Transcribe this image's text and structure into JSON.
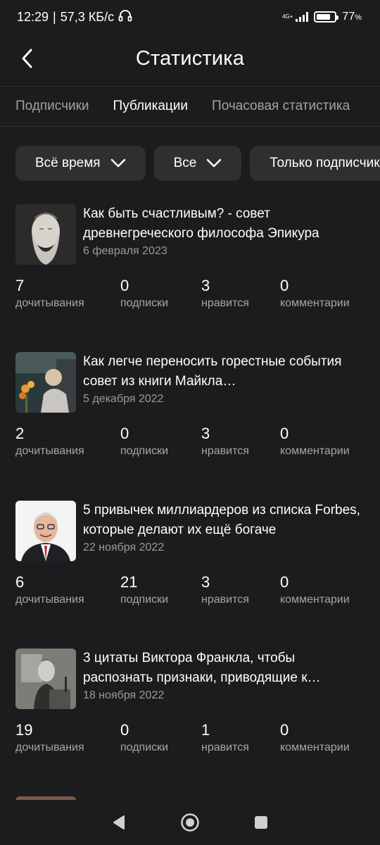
{
  "status_bar": {
    "time": "12:29",
    "separator": "|",
    "speed": "57,3 КБ/с",
    "network": "4G+",
    "battery_level": 0.77,
    "battery_text": "77",
    "battery_unit": "%",
    "icons": [
      "headphones-icon",
      "signal-icon",
      "battery-icon"
    ]
  },
  "header": {
    "title": "Статистика",
    "back_icon": "chevron-left-icon"
  },
  "tabs": [
    {
      "label": "Подписчики",
      "active": false
    },
    {
      "label": "Публикации",
      "active": true
    },
    {
      "label": "Почасовая статистика",
      "active": false
    }
  ],
  "filters": [
    {
      "label": "Всё время",
      "icon": "chevron-down-icon"
    },
    {
      "label": "Все",
      "icon": "chevron-down-icon"
    },
    {
      "label": "Только подписчики"
    }
  ],
  "posts": [
    {
      "title": "Как быть счастливым? - совет древнегреческого философа Эпикура",
      "date": "6 февраля 2023",
      "stats": [
        {
          "value": "7",
          "label": "дочитывания"
        },
        {
          "value": "0",
          "label": "подписки"
        },
        {
          "value": "3",
          "label": "нравится"
        },
        {
          "value": "0",
          "label": "комментарии"
        }
      ]
    },
    {
      "title": "Как легче переносить горестные события совет из книги Майкла…",
      "date": "5 декабря 2022",
      "stats": [
        {
          "value": "2",
          "label": "дочитывания"
        },
        {
          "value": "0",
          "label": "подписки"
        },
        {
          "value": "3",
          "label": "нравится"
        },
        {
          "value": "0",
          "label": "комментарии"
        }
      ]
    },
    {
      "title": "5 привычек миллиардеров из списка Forbes, которые делают их ещё богаче",
      "date": "22 ноября 2022",
      "stats": [
        {
          "value": "6",
          "label": "дочитывания"
        },
        {
          "value": "21",
          "label": "подписки"
        },
        {
          "value": "3",
          "label": "нравится"
        },
        {
          "value": "0",
          "label": "комментарии"
        }
      ]
    },
    {
      "title": "3 цитаты Виктора Франкла, чтобы распознать признаки, приводящие к…",
      "date": "18 ноября 2022",
      "stats": [
        {
          "value": "19",
          "label": "дочитывания"
        },
        {
          "value": "0",
          "label": "подписки"
        },
        {
          "value": "1",
          "label": "нравится"
        },
        {
          "value": "0",
          "label": "комментарии"
        }
      ]
    }
  ],
  "navbar": {
    "icons": [
      "back-triangle-icon",
      "home-circle-icon",
      "recents-square-icon"
    ]
  },
  "colors": {
    "background": "#1c1c1e",
    "chip": "#2f2f31",
    "muted_text": "#a6a6aa"
  }
}
